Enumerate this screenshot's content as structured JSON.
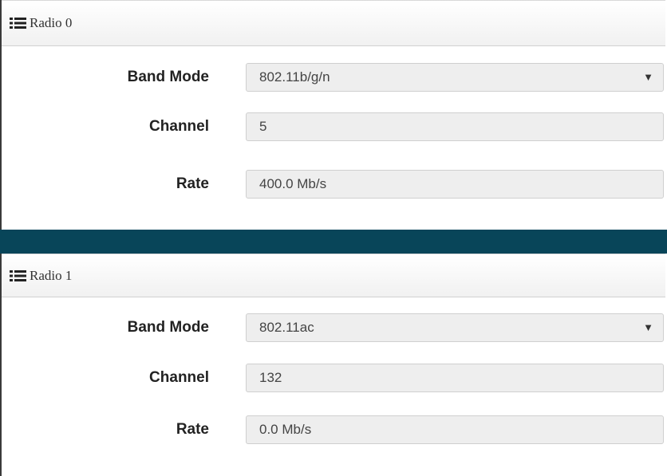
{
  "radios": [
    {
      "title": "Radio 0",
      "band_mode_label": "Band Mode",
      "band_mode_value": "802.11b/g/n",
      "channel_label": "Channel",
      "channel_value": "5",
      "rate_label": "Rate",
      "rate_value": "400.0 Mb/s"
    },
    {
      "title": "Radio 1",
      "band_mode_label": "Band Mode",
      "band_mode_value": "802.11ac",
      "channel_label": "Channel",
      "channel_value": "132",
      "rate_label": "Rate",
      "rate_value": "0.0 Mb/s"
    }
  ],
  "icons": {
    "header": "list-icon",
    "select": "caret-down-icon"
  },
  "colors": {
    "divider": "#084559",
    "field_bg": "#eeeeee"
  }
}
